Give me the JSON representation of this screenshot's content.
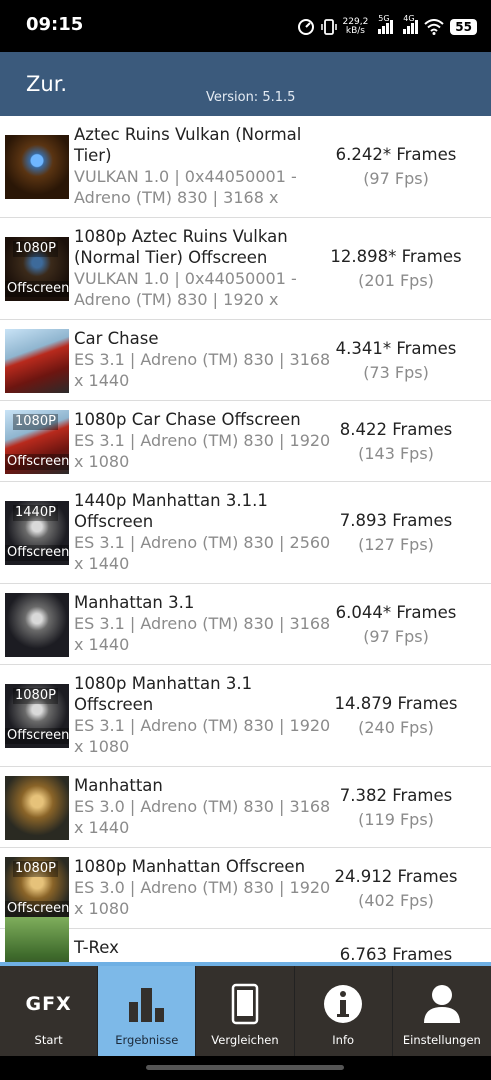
{
  "statusbar": {
    "time": "09:15",
    "speed_value": "229,2",
    "speed_unit": "kB/s",
    "net1": "5G",
    "net2": "4G",
    "battery": "55",
    "icons": [
      "speedometer-icon",
      "vibrate-icon",
      "signal-icon",
      "wifi-icon",
      "battery-icon"
    ]
  },
  "header": {
    "back_label": "Zur.",
    "version": "Version: 5.1.5",
    "color": "#3b5a7c"
  },
  "results": [
    {
      "name": "Aztec Ruins Vulkan (Normal Tier)",
      "spec": "VULKAN 1.0 | 0x44050001 - Adreno (TM) 830 | 3168 x",
      "frames": "6.242* Frames",
      "fps": "(97 Fps)",
      "thumb": "aztec",
      "tag_top": "",
      "tag_bottom": ""
    },
    {
      "name": "1080p Aztec Ruins Vulkan (Normal Tier) Offscreen",
      "spec": "VULKAN 1.0 | 0x44050001 - Adreno (TM) 830 | 1920 x",
      "frames": "12.898* Frames",
      "fps": "(201 Fps)",
      "thumb": "aztec-dark",
      "tag_top": "1080P",
      "tag_bottom": "Offscreen"
    },
    {
      "name": "Car Chase",
      "spec": "ES 3.1 | Adreno (TM) 830 | 3168 x 1440",
      "frames": "4.341* Frames",
      "fps": "(73 Fps)",
      "thumb": "car",
      "tag_top": "",
      "tag_bottom": ""
    },
    {
      "name": "1080p Car Chase Offscreen",
      "spec": "ES 3.1 | Adreno (TM) 830 | 1920 x 1080",
      "frames": "8.422 Frames",
      "fps": "(143 Fps)",
      "thumb": "car",
      "tag_top": "1080P",
      "tag_bottom": "Offscreen"
    },
    {
      "name": "1440p Manhattan 3.1.1 Offscreen",
      "spec": "ES 3.1 | Adreno (TM) 830 | 2560 x 1440",
      "frames": "7.893 Frames",
      "fps": "(127 Fps)",
      "thumb": "robot",
      "tag_top": "1440P",
      "tag_bottom": "Offscreen"
    },
    {
      "name": "Manhattan 3.1",
      "spec": "ES 3.1 | Adreno (TM) 830 | 3168 x 1440",
      "frames": "6.044* Frames",
      "fps": "(97 Fps)",
      "thumb": "robot",
      "tag_top": "",
      "tag_bottom": ""
    },
    {
      "name": "1080p Manhattan 3.1 Offscreen",
      "spec": "ES 3.1 | Adreno (TM) 830 | 1920 x 1080",
      "frames": "14.879 Frames",
      "fps": "(240 Fps)",
      "thumb": "robot",
      "tag_top": "1080P",
      "tag_bottom": "Offscreen"
    },
    {
      "name": "Manhattan",
      "spec": "ES 3.0 | Adreno (TM) 830 | 3168 x 1440",
      "frames": "7.382 Frames",
      "fps": "(119 Fps)",
      "thumb": "gold-robot",
      "tag_top": "",
      "tag_bottom": ""
    },
    {
      "name": "1080p Manhattan Offscreen",
      "spec": "ES 3.0 | Adreno (TM) 830 | 1920 x 1080",
      "frames": "24.912 Frames",
      "fps": "(402 Fps)",
      "thumb": "gold-robot",
      "tag_top": "1080P",
      "tag_bottom": "Offscreen"
    },
    {
      "name": "T-Rex",
      "spec": "",
      "frames": "6.763 Frames",
      "fps": "",
      "thumb": "trex",
      "tag_top": "",
      "tag_bottom": ""
    }
  ],
  "nav": [
    {
      "label": "Start",
      "icon": "gfx-logo-icon",
      "text": "GFX",
      "active": false
    },
    {
      "label": "Ergebnisse",
      "icon": "bar-chart-icon",
      "active": true
    },
    {
      "label": "Vergleichen",
      "icon": "phone-icon",
      "active": false
    },
    {
      "label": "Info",
      "icon": "info-icon",
      "active": false
    },
    {
      "label": "Einstellungen",
      "icon": "user-icon",
      "active": false
    }
  ]
}
